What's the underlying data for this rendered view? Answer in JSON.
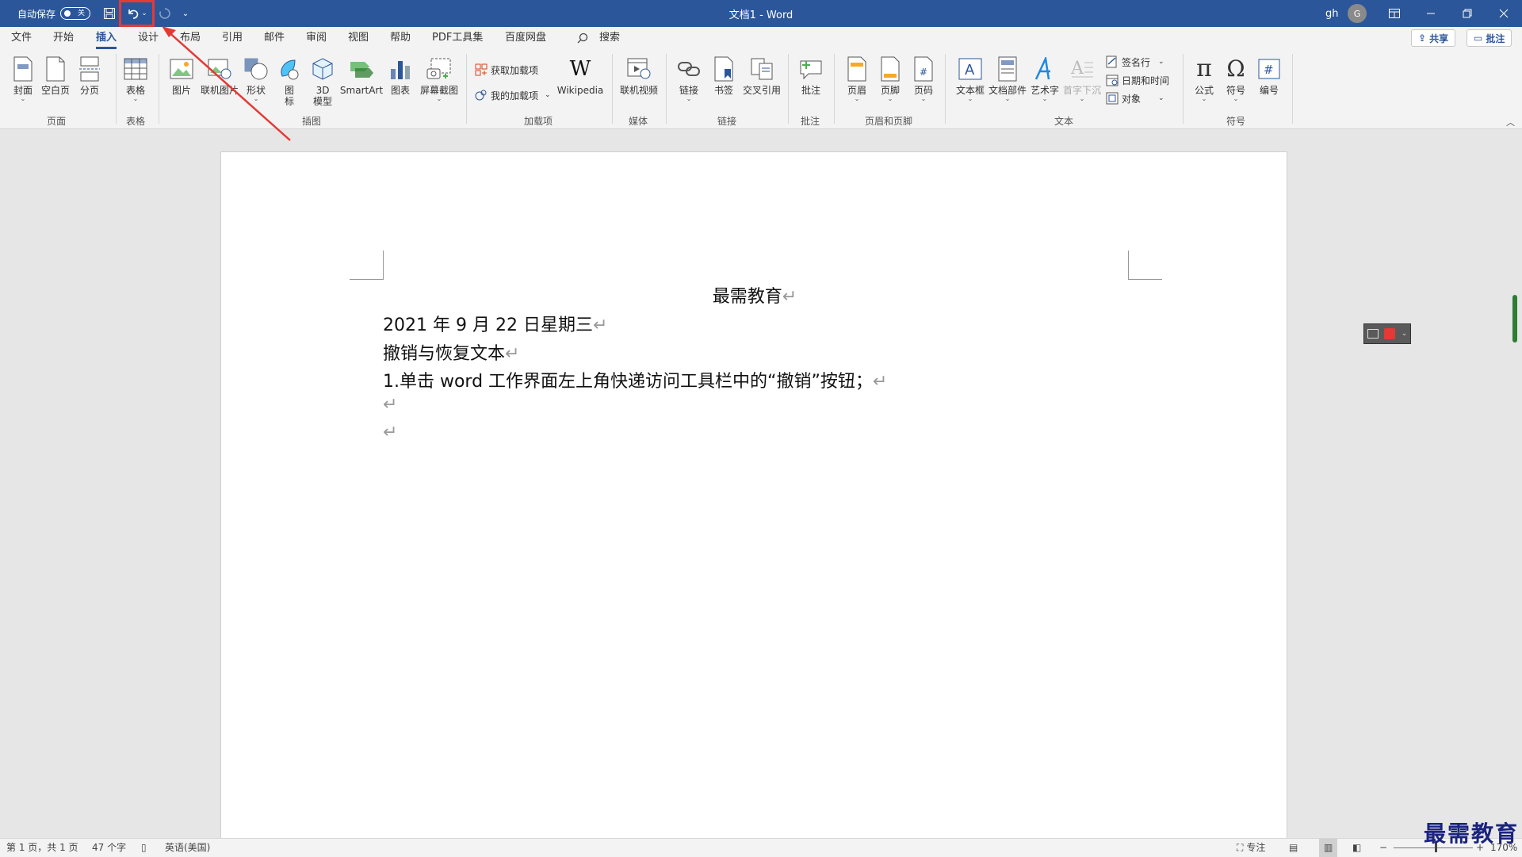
{
  "titlebar": {
    "autosave_label": "自动保存",
    "autosave_state": "关",
    "doc_title": "文档1  -  Word",
    "user_initials": "gh",
    "avatar_letter": "G"
  },
  "tabs": [
    "文件",
    "开始",
    "插入",
    "设计",
    "布局",
    "引用",
    "邮件",
    "审阅",
    "视图",
    "帮助",
    "PDF工具集",
    "百度网盘"
  ],
  "active_tab": "插入",
  "search_label": "搜索",
  "share_label": "共享",
  "comments_label": "批注",
  "ribbon": {
    "pages": {
      "cover": "封面",
      "blank": "空白页",
      "break": "分页",
      "group": "页面"
    },
    "tables": {
      "table": "表格",
      "group": "表格"
    },
    "illustrations": {
      "picture": "图片",
      "online_picture": "联机图片",
      "shapes": "形状",
      "icons_l1": "图",
      "icons_l2": "标",
      "model_l1": "3D",
      "model_l2": "模型",
      "smartart": "SmartArt",
      "chart": "图表",
      "screenshot": "屏幕截图",
      "group": "插图"
    },
    "addins": {
      "get": "获取加载项",
      "mine": "我的加载项",
      "wikipedia": "Wikipedia",
      "group": "加载项"
    },
    "media": {
      "video": "联机视频",
      "group": "媒体"
    },
    "links": {
      "link": "链接",
      "bookmark": "书签",
      "crossref": "交叉引用",
      "group": "链接"
    },
    "comments": {
      "comment": "批注",
      "group": "批注"
    },
    "header_footer": {
      "header": "页眉",
      "footer": "页脚",
      "pagenum": "页码",
      "group": "页眉和页脚"
    },
    "text": {
      "textbox": "文本框",
      "quickparts": "文档部件",
      "wordart": "艺术字",
      "dropcap": "首字下沉",
      "signature": "签名行",
      "datetime": "日期和时间",
      "object": "对象",
      "group": "文本"
    },
    "symbols": {
      "equation": "公式",
      "symbol": "符号",
      "number": "编号",
      "group": "符号"
    }
  },
  "document": {
    "title": "最需教育",
    "line1": "2021 年 9 月 22 日星期三",
    "line2": "撤销与恢复文本",
    "line3": "1.单击 word 工作界面左上角快递访问工具栏中的“撤销”按钮；",
    "para_mark": "↵"
  },
  "statusbar": {
    "page": "第 1 页，共 1 页",
    "words": "47 个字",
    "language": "英语(美国)",
    "focus": "专注",
    "zoom": "170%"
  },
  "watermark": "最需教育",
  "colors": {
    "brand": "#2b579a",
    "annotation": "#e53935"
  }
}
